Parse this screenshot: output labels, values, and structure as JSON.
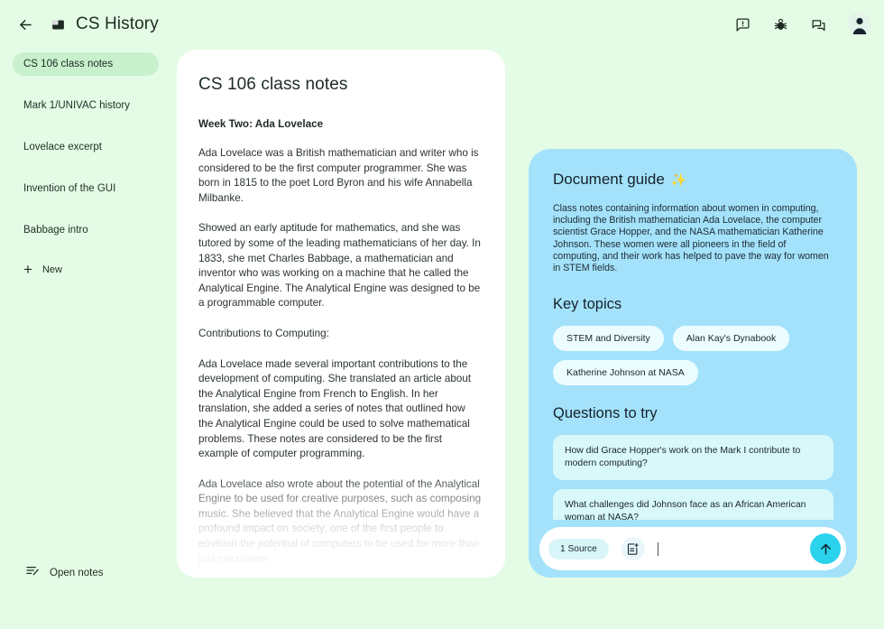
{
  "app": {
    "title": "CS History",
    "background_color": "#e4fce5",
    "accent_blue": "#a4e2fb",
    "accent_cyan": "#2ad2ec",
    "active_chip_color": "#c8f0cd"
  },
  "topbar": {
    "back_icon": "arrow-left-icon",
    "logo_icon": "app-logo-icon",
    "actions": [
      {
        "name": "feedback-icon",
        "label": "Send feedback"
      },
      {
        "name": "bug-report-icon",
        "label": "Report a bug"
      },
      {
        "name": "chat-icon",
        "label": "Chat"
      }
    ],
    "avatar_label": "Account"
  },
  "sidebar": {
    "items": [
      {
        "label": "CS 106 class notes",
        "active": true
      },
      {
        "label": "Mark 1/UNIVAC history",
        "active": false
      },
      {
        "label": "Lovelace excerpt",
        "active": false
      },
      {
        "label": "Invention of the GUI",
        "active": false
      },
      {
        "label": "Babbage intro",
        "active": false
      }
    ],
    "new_label": "New",
    "new_icon": "plus-icon",
    "open_notes_label": "Open notes",
    "open_notes_icon": "edit-note-icon"
  },
  "document": {
    "title": "CS 106 class notes",
    "subtitle": "Week Two: Ada Lovelace",
    "paragraphs": [
      "Ada Lovelace was a British mathematician and writer who is considered to be the first computer programmer. She was born in 1815 to the poet Lord Byron and his wife Annabella Milbanke.",
      "Showed an early aptitude for mathematics, and she was tutored by some of the leading mathematicians of her day. In 1833, she met Charles Babbage, a mathematician and inventor who was working on a machine that he called the Analytical Engine. The Analytical Engine was designed to be a programmable computer.",
      "Contributions to Computing:",
      "Ada Lovelace made several important contributions to the development of computing. She translated an article about the Analytical Engine from French to English. In her translation, she added a series of notes that outlined how the Analytical Engine could be used to solve mathematical problems. These notes are considered to be the first example of computer programming.",
      "Ada Lovelace also wrote about the potential of the Analytical Engine to be used for creative purposes, such as composing music. She believed that the Analytical Engine would have a profound impact on society; one of the first people to envision the potential of computers to be used for more than just calculation."
    ]
  },
  "guide": {
    "heading": "Document guide",
    "sparkle": "✨",
    "description": "Class notes containing information about women in computing, including the British mathematician Ada Lovelace, the computer scientist Grace Hopper, and the NASA mathematician Katherine Johnson. These women were all pioneers in the field of computing, and their work has helped to pave the way for women in STEM fields.",
    "key_topics_heading": "Key topics",
    "key_topics": [
      "STEM and Diversity",
      "Alan Kay's Dynabook",
      "Katherine Johnson at NASA"
    ],
    "questions_heading": "Questions to try",
    "questions": [
      "How did Grace Hopper's work on the Mark I contribute to modern computing?",
      "What challenges did Johnson face as an African American woman at NASA?"
    ]
  },
  "composer": {
    "source_chip_label": "1 Source",
    "add_note_icon": "note-add-icon",
    "input_value": "",
    "input_placeholder": "",
    "send_icon": "arrow-up-icon"
  }
}
